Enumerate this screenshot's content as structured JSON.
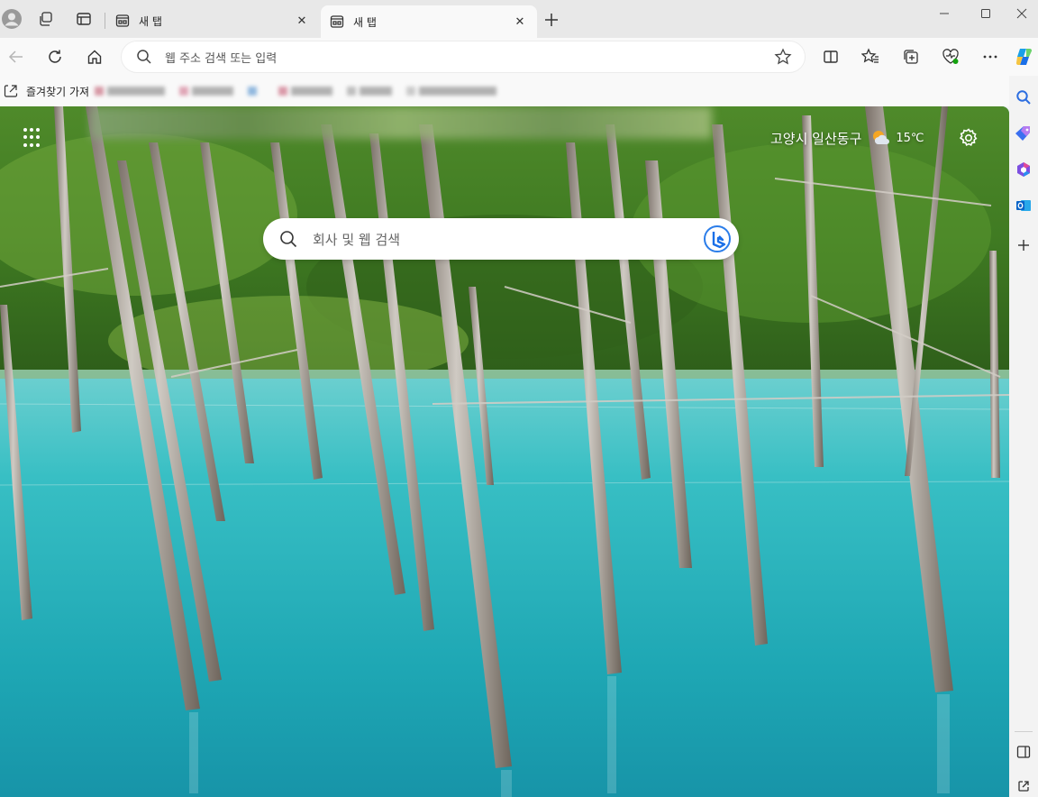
{
  "tabs": [
    {
      "label": "새 탭",
      "close": "✕"
    },
    {
      "label": "새 탭",
      "close": "✕"
    }
  ],
  "new_tab_icon": "plus-icon",
  "window_controls": [
    "minimize-icon",
    "maximize-icon",
    "close-icon"
  ],
  "toolbar": {
    "address_placeholder": "웹 주소 검색 또는 입력",
    "icons": [
      "back-icon",
      "refresh-icon",
      "home-icon",
      "star-icon",
      "split-screen-icon",
      "favorites-icon",
      "collections-icon",
      "browser-essentials-icon",
      "more-icon",
      "copilot-icon"
    ]
  },
  "favorites_bar": {
    "import_label": "즐겨찾기 가져"
  },
  "newtab_page": {
    "location": "고양시 일산동구",
    "temperature": "15℃",
    "weather_icon": "partly-cloudy-icon",
    "search_placeholder": "회사 및 웹 검색"
  },
  "sidebar": {
    "icons": [
      "search-icon",
      "shopping-tag-icon",
      "office-icon",
      "outlook-icon",
      "add-icon",
      "sidebar-layout-icon",
      "open-external-icon"
    ]
  },
  "colors": {
    "accent": "#0078d4",
    "tabstrip": "#e8e8e8",
    "toolbar": "#f9f9f9"
  }
}
